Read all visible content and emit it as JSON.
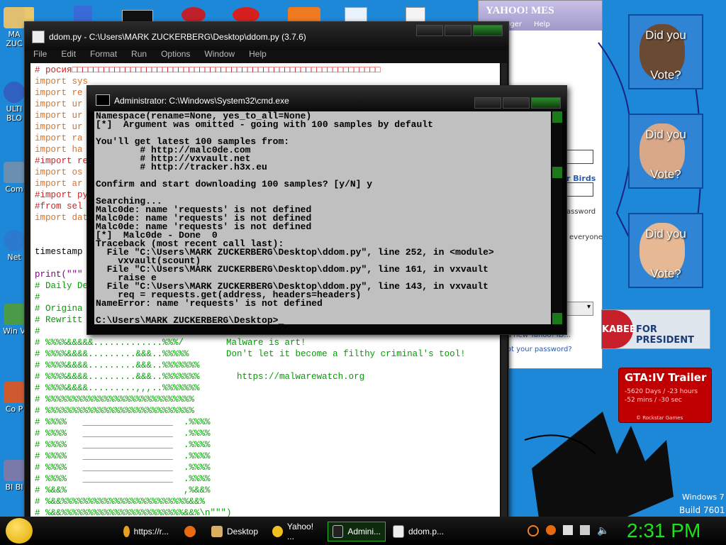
{
  "desktop": {
    "left_icons": [
      "MA ZUC",
      "ULTI BLO",
      "Com",
      "Net",
      "Win V",
      "Co P",
      "BI BI"
    ],
    "top_icon_count": 6
  },
  "idle": {
    "title": "ddom.py - C:\\Users\\MARK ZUCKERBERG\\Desktop\\ddom.py (3.7.6)",
    "menu": [
      "File",
      "Edit",
      "Format",
      "Run",
      "Options",
      "Window",
      "Help"
    ],
    "lines": [
      {
        "t": "# росия□□□□□□□□□□□□□□□□□□□□□□□□□□□□□□□□□□□□□□□□□□□□□□□□□□□□□□□□□□",
        "c": "cm"
      },
      {
        "t": "import sys",
        "c": "kw"
      },
      {
        "t": "import re",
        "c": "kw"
      },
      {
        "t": "import ur",
        "c": "kw"
      },
      {
        "t": "import ur",
        "c": "kw"
      },
      {
        "t": "import ur",
        "c": "kw"
      },
      {
        "t": "import ra",
        "c": "kw"
      },
      {
        "t": "import ha",
        "c": "kw"
      },
      {
        "t": "#import re",
        "c": "cm"
      },
      {
        "t": "import os",
        "c": "kw"
      },
      {
        "t": "import ar",
        "c": "kw"
      },
      {
        "t": "#import py",
        "c": "cm"
      },
      {
        "t": "#from sel",
        "c": "cm"
      },
      {
        "t": "import dat",
        "c": "kw"
      },
      {
        "t": "",
        "c": "bk"
      },
      {
        "t": "",
        "c": "bk"
      },
      {
        "t": "timestamp",
        "c": "bk"
      },
      {
        "t": "",
        "c": "bk"
      },
      {
        "t": "print(\"\"\"",
        "c": "fn"
      },
      {
        "t": "# Daily De",
        "c": "gr"
      },
      {
        "t": "#",
        "c": "gr"
      },
      {
        "t": "# Origina",
        "c": "gr"
      },
      {
        "t": "# Rewritt",
        "c": "gr"
      },
      {
        "t": "#",
        "c": "gr"
      },
      {
        "t": "# %%%%&&&&&.............%%%/        Malware is art!",
        "c": "gr"
      },
      {
        "t": "# %%%%&&&&.........&&&..%%%%%       Don't let it become a filthy criminal's tool!",
        "c": "gr"
      },
      {
        "t": "# %%%%&&&&.........&&&..%%%%%%%",
        "c": "gr"
      },
      {
        "t": "# %%%%&&&&.........&&&..%%%%%%%       https://malwarewatch.org",
        "c": "gr"
      },
      {
        "t": "# %%%%&&&&.........,,,..%%%%%%%",
        "c": "gr"
      },
      {
        "t": "# %%%%%%%%%%%%%%%%%%%%%%%%%%%%",
        "c": "gr"
      },
      {
        "t": "# %%%%%%%%%%%%%%%%%%%%%%%%%%%%",
        "c": "gr"
      },
      {
        "t": "# %%%%   _________________  .%%%%",
        "c": "gr"
      },
      {
        "t": "# %%%%   _________________  .%%%%",
        "c": "gr"
      },
      {
        "t": "# %%%%   _________________  .%%%%",
        "c": "gr"
      },
      {
        "t": "# %%%%   _________________  .%%%%",
        "c": "gr"
      },
      {
        "t": "# %%%%   _________________  .%%%%",
        "c": "gr"
      },
      {
        "t": "# %%%%   _________________  .%%%%",
        "c": "gr"
      },
      {
        "t": "# %&&%                      ,%&&%",
        "c": "gr"
      },
      {
        "t": "# %&&%%%%%%%%%%%%%%%%%%%%%%%%&&%",
        "c": "gr"
      },
      {
        "t": "# %&&%%%%%%%%%%%%%%%%%%%%%%%&&%\\n\"\"\")",
        "c": "gr"
      }
    ]
  },
  "cmd": {
    "title": "Administrator: C:\\Windows\\System32\\cmd.exe",
    "lines": [
      "Namespace(rename=None, yes_to_all=None)",
      "[*]  Argument was omitted - going with 100 samples by default",
      "",
      "You'll get latest 100 samples from:",
      "        # http://malc0de.com",
      "        # http://vxvault.net",
      "        # http://tracker.h3x.eu",
      "",
      "Confirm and start downloading 100 samples? [y/N] y",
      "",
      "Searching...",
      "Malc0de: name 'requests' is not defined",
      "Malc0de: name 'requests' is not defined",
      "Malc0de: name 'requests' is not defined",
      "[*]  Malc0de - Done  0",
      "Traceback (most recent call last):",
      "  File \"C:\\Users\\MARK ZUCKERBERG\\Desktop\\ddom.py\", line 252, in <module>",
      "    vxvault(scount)",
      "  File \"C:\\Users\\MARK ZUCKERBERG\\Desktop\\ddom.py\", line 161, in vxvault",
      "    raise e",
      "  File \"C:\\Users\\MARK ZUCKERBERG\\Desktop\\ddom.py\", line 143, in vxvault",
      "    req = requests.get(address, headers=headers)",
      "NameError: name 'requests' is not defined",
      "",
      "C:\\Users\\MARK ZUCKERBERG\\Desktop>_"
    ]
  },
  "yahoo": {
    "title": "YAHOO! MES",
    "menu": [
      "nger",
      "Help"
    ],
    "birds": "r Birds",
    "password": "assword",
    "everyone": "everyone",
    "new_id": "a new Yahoo! ID...",
    "forgot": "ot your password?"
  },
  "posters": [
    {
      "top": "Did you",
      "bottom": "Vote?",
      "face": "#6b4a34"
    },
    {
      "top": "Did you",
      "bottom": "Vote?",
      "face": "#d8a888"
    },
    {
      "top": "Did you",
      "bottom": "Vote?",
      "face": "#e6b894"
    }
  ],
  "huckabee": {
    "left": "KABEE",
    "right": "FOR PRESIDENT"
  },
  "gta": {
    "title": "GTA:IV Trailer",
    "line1": "-5620 Days / -23 hours",
    "line2": "-52 mins / -30 sec",
    "credit": "© Rockstar Games"
  },
  "watermark": {
    "os": "Windows 7",
    "build": "Build 7601"
  },
  "taskbar": {
    "items": [
      {
        "label": "https://r...",
        "color": "#e8a020"
      },
      {
        "label": "",
        "color": "#e86a10"
      },
      {
        "label": "Desktop",
        "color": "#d8b060"
      },
      {
        "label": "Yahoo! ...",
        "color": "#f0c020"
      },
      {
        "label": "Admini...",
        "color": "#222"
      },
      {
        "label": "ddom.p...",
        "color": "#4a78c8"
      }
    ],
    "clock": "2:31 PM"
  }
}
